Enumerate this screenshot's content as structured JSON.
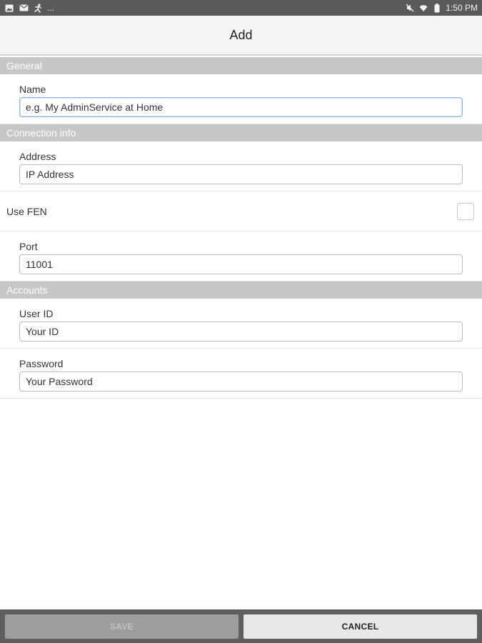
{
  "status_bar": {
    "left_icons": [
      "image-icon",
      "mail-icon",
      "running-person-icon"
    ],
    "overflow": "...",
    "right_icons": [
      "mute-icon",
      "wifi-icon",
      "battery-icon"
    ],
    "time": "1:50 PM"
  },
  "header": {
    "title": "Add"
  },
  "sections": {
    "general": {
      "title": "General",
      "name": {
        "label": "Name",
        "placeholder": "e.g. My AdminService at Home"
      }
    },
    "connection": {
      "title": "Connection info",
      "address": {
        "label": "Address",
        "placeholder": "IP Address"
      },
      "use_fen": {
        "label": "Use FEN",
        "checked": false
      },
      "port": {
        "label": "Port",
        "value": "11001"
      }
    },
    "accounts": {
      "title": "Accounts",
      "user_id": {
        "label": "User ID",
        "placeholder": "Your ID"
      },
      "password": {
        "label": "Password",
        "placeholder": "Your Password"
      }
    }
  },
  "footer": {
    "save_label": "SAVE",
    "cancel_label": "CANCEL"
  },
  "colors": {
    "status_bar": "#5a5a5a",
    "section_header": "#c7c7c7",
    "focused_border": "#8fb9e3",
    "bottom_bar": "#5f5f5f"
  }
}
